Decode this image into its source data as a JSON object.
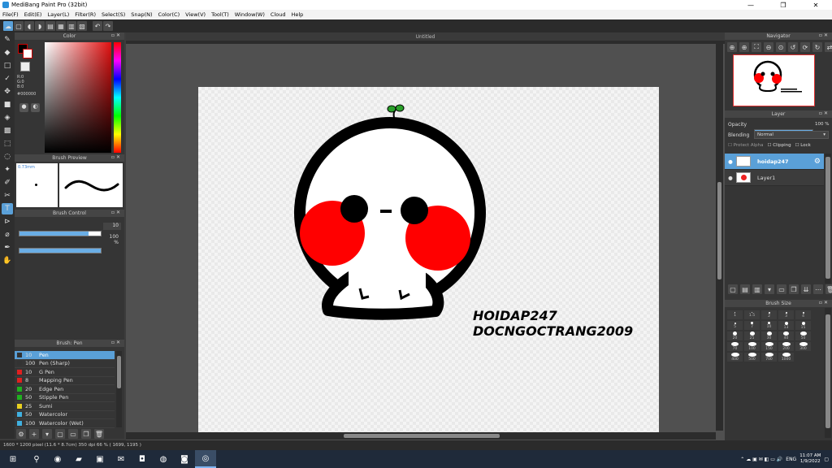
{
  "window": {
    "title": "MediBang Paint Pro (32bit)",
    "min": "—",
    "max": "❐",
    "close": "✕"
  },
  "menu": [
    "File(F)",
    "Edit(E)",
    "Layer(L)",
    "Filter(R)",
    "Select(S)",
    "Snap(N)",
    "Color(C)",
    "View(V)",
    "Tool(T)",
    "Window(W)",
    "Cloud",
    "Help"
  ],
  "panels": {
    "color": "Color",
    "brush_preview": "Brush Preview",
    "brush_control": "Brush Control",
    "brush_list": "Brush: Pen",
    "navigator": "Navigator",
    "layer": "Layer",
    "brush_size": "Brush Size"
  },
  "color": {
    "r": "R:0",
    "g": "G:0",
    "b": "B:0",
    "hex": "#000000"
  },
  "brush_preview": {
    "size": "0.73mm"
  },
  "brush_control": {
    "size_value": "10",
    "opacity_value": "100 %",
    "size_level": 0.85,
    "opacity_level": 1.0
  },
  "brushes": [
    {
      "size": "10",
      "name": "Pen",
      "color": "#333333"
    },
    {
      "size": "100",
      "name": "Pen (Sharp)",
      "color": "#333333"
    },
    {
      "size": "10",
      "name": "G Pen",
      "color": "#e02020"
    },
    {
      "size": "8",
      "name": "Mapping Pen",
      "color": "#e02020"
    },
    {
      "size": "20",
      "name": "Edge Pen",
      "color": "#20b020"
    },
    {
      "size": "50",
      "name": "Stipple Pen",
      "color": "#20b020"
    },
    {
      "size": "25",
      "name": "Sumi",
      "color": "#e8d020"
    },
    {
      "size": "50",
      "name": "Watercolor",
      "color": "#40b0e0"
    },
    {
      "size": "100",
      "name": "Watercolor (Wet)",
      "color": "#40b0e0"
    }
  ],
  "document": {
    "tab": "Untitled"
  },
  "artwork": {
    "line1": "HOIDAP247",
    "line2": "DOCNGOCTRANG2009"
  },
  "layer_panel": {
    "opacity_label": "Opacity",
    "opacity_value": "100 %",
    "opacity_level": 1.0,
    "blending_label": "Blending",
    "blending_value": "Normal",
    "protect_alpha": "Protect Alpha",
    "clipping": "Clipping",
    "lock": "Lock",
    "layers": [
      {
        "name": "hoidap247",
        "selected": true
      },
      {
        "name": "Layer1",
        "selected": false
      }
    ]
  },
  "brush_sizes": [
    "1",
    "1.5",
    "2",
    "3",
    "4",
    "5",
    "7",
    "10",
    "13",
    "15",
    "20",
    "25",
    "30",
    "40",
    "50",
    "70",
    "100",
    "150",
    "200",
    "300",
    "400",
    "500",
    "700",
    "1000"
  ],
  "status": "1600 * 1200 pixel   (11.6 * 8.7cm)   350 dpi   66 %   ( 1699, 1195 )",
  "taskbar": {
    "time": "11:07 AM",
    "date": "1/9/2022",
    "lang": "ENG"
  }
}
